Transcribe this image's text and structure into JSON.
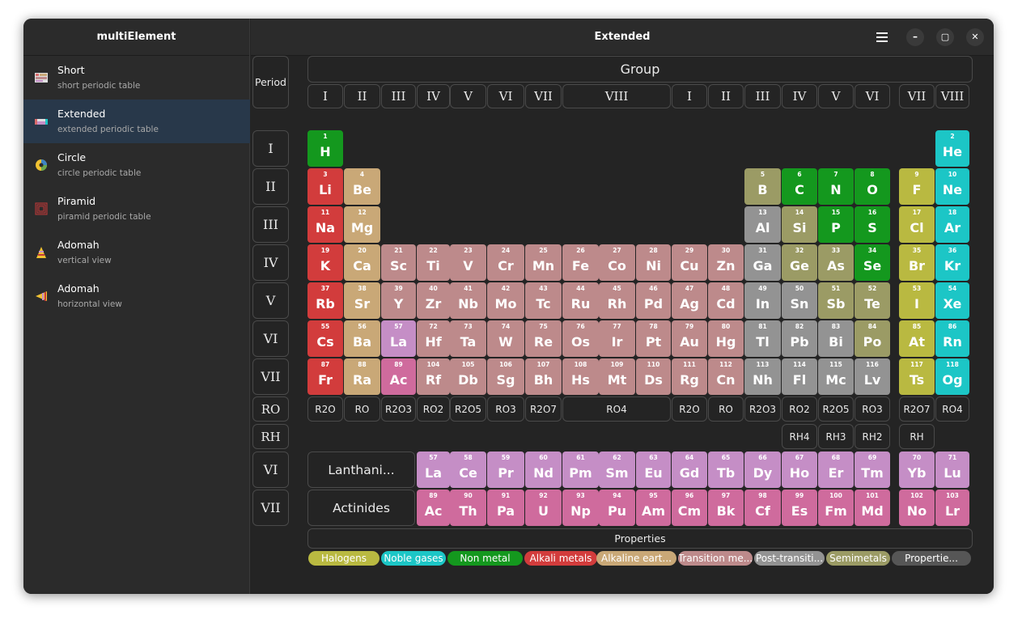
{
  "app": {
    "sidebar_title": "multiElement",
    "page_title": "Extended"
  },
  "window_buttons": {
    "minimize": "–",
    "maximize": "▢",
    "close": "✕"
  },
  "sidebar": {
    "items": [
      {
        "title": "Short",
        "subtitle": "short periodic table",
        "icon": "short-table-icon"
      },
      {
        "title": "Extended",
        "subtitle": "extended periodic table",
        "icon": "extended-table-icon"
      },
      {
        "title": "Circle",
        "subtitle": "circle periodic table",
        "icon": "circle-table-icon"
      },
      {
        "title": "Piramid",
        "subtitle": "piramid periodic table",
        "icon": "piramid-table-icon"
      },
      {
        "title": "Adomah",
        "subtitle": "vertical view",
        "icon": "adomah-vertical-icon"
      },
      {
        "title": "Adomah",
        "subtitle": "horizontal view",
        "icon": "adomah-horizontal-icon"
      }
    ],
    "active_index": 1
  },
  "headers": {
    "period": "Period",
    "group": "Group",
    "groups": [
      "I",
      "II",
      "III",
      "IV",
      "V",
      "VI",
      "VII",
      "VIII",
      "I",
      "II",
      "III",
      "IV",
      "V",
      "VI",
      "VII",
      "VIII"
    ],
    "periods": [
      "I",
      "II",
      "III",
      "IV",
      "V",
      "VI",
      "VII"
    ],
    "ro": "RO",
    "rh": "RH",
    "lanth_period": "VI",
    "actin_period": "VII",
    "lanthanides": "Lanthani...",
    "actinides": "Actinides",
    "properties": "Properties"
  },
  "colors": {
    "halogen": "#b9b941",
    "noble": "#1cc6c6",
    "nonmetal": "#14981e",
    "alkali": "#d23c3c",
    "alkaline": "#c9a877",
    "transition": "#bd8a8b",
    "post": "#939393",
    "semi": "#9b9b65",
    "lanth": "#c58ec6",
    "actin": "#cf6b9d",
    "unknown": "#565656",
    "header_bg": "#2b2b2b",
    "window_bg": "#242424",
    "sidebar_active": "#28384a"
  },
  "elements": [
    {
      "z": 1,
      "s": "H",
      "c": "nonmetal"
    },
    {
      "z": 2,
      "s": "He",
      "c": "noble"
    },
    {
      "z": 3,
      "s": "Li",
      "c": "alkali"
    },
    {
      "z": 4,
      "s": "Be",
      "c": "alkaline"
    },
    {
      "z": 5,
      "s": "B",
      "c": "semi"
    },
    {
      "z": 6,
      "s": "C",
      "c": "nonmetal"
    },
    {
      "z": 7,
      "s": "N",
      "c": "nonmetal"
    },
    {
      "z": 8,
      "s": "O",
      "c": "nonmetal"
    },
    {
      "z": 9,
      "s": "F",
      "c": "halogen"
    },
    {
      "z": 10,
      "s": "Ne",
      "c": "noble"
    },
    {
      "z": 11,
      "s": "Na",
      "c": "alkali"
    },
    {
      "z": 12,
      "s": "Mg",
      "c": "alkaline"
    },
    {
      "z": 13,
      "s": "Al",
      "c": "post"
    },
    {
      "z": 14,
      "s": "Si",
      "c": "semi"
    },
    {
      "z": 15,
      "s": "P",
      "c": "nonmetal"
    },
    {
      "z": 16,
      "s": "S",
      "c": "nonmetal"
    },
    {
      "z": 17,
      "s": "Cl",
      "c": "halogen"
    },
    {
      "z": 18,
      "s": "Ar",
      "c": "noble"
    },
    {
      "z": 19,
      "s": "K",
      "c": "alkali"
    },
    {
      "z": 20,
      "s": "Ca",
      "c": "alkaline"
    },
    {
      "z": 21,
      "s": "Sc",
      "c": "transition"
    },
    {
      "z": 22,
      "s": "Ti",
      "c": "transition"
    },
    {
      "z": 23,
      "s": "V",
      "c": "transition"
    },
    {
      "z": 24,
      "s": "Cr",
      "c": "transition"
    },
    {
      "z": 25,
      "s": "Mn",
      "c": "transition"
    },
    {
      "z": 26,
      "s": "Fe",
      "c": "transition"
    },
    {
      "z": 27,
      "s": "Co",
      "c": "transition"
    },
    {
      "z": 28,
      "s": "Ni",
      "c": "transition"
    },
    {
      "z": 29,
      "s": "Cu",
      "c": "transition"
    },
    {
      "z": 30,
      "s": "Zn",
      "c": "transition"
    },
    {
      "z": 31,
      "s": "Ga",
      "c": "post"
    },
    {
      "z": 32,
      "s": "Ge",
      "c": "semi"
    },
    {
      "z": 33,
      "s": "As",
      "c": "semi"
    },
    {
      "z": 34,
      "s": "Se",
      "c": "nonmetal"
    },
    {
      "z": 35,
      "s": "Br",
      "c": "halogen"
    },
    {
      "z": 36,
      "s": "Kr",
      "c": "noble"
    },
    {
      "z": 37,
      "s": "Rb",
      "c": "alkali"
    },
    {
      "z": 38,
      "s": "Sr",
      "c": "alkaline"
    },
    {
      "z": 39,
      "s": "Y",
      "c": "transition"
    },
    {
      "z": 40,
      "s": "Zr",
      "c": "transition"
    },
    {
      "z": 41,
      "s": "Nb",
      "c": "transition"
    },
    {
      "z": 42,
      "s": "Mo",
      "c": "transition"
    },
    {
      "z": 43,
      "s": "Tc",
      "c": "transition"
    },
    {
      "z": 44,
      "s": "Ru",
      "c": "transition"
    },
    {
      "z": 45,
      "s": "Rh",
      "c": "transition"
    },
    {
      "z": 46,
      "s": "Pd",
      "c": "transition"
    },
    {
      "z": 47,
      "s": "Ag",
      "c": "transition"
    },
    {
      "z": 48,
      "s": "Cd",
      "c": "transition"
    },
    {
      "z": 49,
      "s": "In",
      "c": "post"
    },
    {
      "z": 50,
      "s": "Sn",
      "c": "post"
    },
    {
      "z": 51,
      "s": "Sb",
      "c": "semi"
    },
    {
      "z": 52,
      "s": "Te",
      "c": "semi"
    },
    {
      "z": 53,
      "s": "I",
      "c": "halogen"
    },
    {
      "z": 54,
      "s": "Xe",
      "c": "noble"
    },
    {
      "z": 55,
      "s": "Cs",
      "c": "alkali"
    },
    {
      "z": 56,
      "s": "Ba",
      "c": "alkaline"
    },
    {
      "z": 57,
      "s": "La",
      "c": "lanth"
    },
    {
      "z": 72,
      "s": "Hf",
      "c": "transition"
    },
    {
      "z": 73,
      "s": "Ta",
      "c": "transition"
    },
    {
      "z": 74,
      "s": "W",
      "c": "transition"
    },
    {
      "z": 75,
      "s": "Re",
      "c": "transition"
    },
    {
      "z": 76,
      "s": "Os",
      "c": "transition"
    },
    {
      "z": 77,
      "s": "Ir",
      "c": "transition"
    },
    {
      "z": 78,
      "s": "Pt",
      "c": "transition"
    },
    {
      "z": 79,
      "s": "Au",
      "c": "transition"
    },
    {
      "z": 80,
      "s": "Hg",
      "c": "transition"
    },
    {
      "z": 81,
      "s": "Tl",
      "c": "post"
    },
    {
      "z": 82,
      "s": "Pb",
      "c": "post"
    },
    {
      "z": 83,
      "s": "Bi",
      "c": "post"
    },
    {
      "z": 84,
      "s": "Po",
      "c": "semi"
    },
    {
      "z": 85,
      "s": "At",
      "c": "halogen"
    },
    {
      "z": 86,
      "s": "Rn",
      "c": "noble"
    },
    {
      "z": 87,
      "s": "Fr",
      "c": "alkali"
    },
    {
      "z": 88,
      "s": "Ra",
      "c": "alkaline"
    },
    {
      "z": 89,
      "s": "Ac",
      "c": "actin"
    },
    {
      "z": 104,
      "s": "Rf",
      "c": "transition"
    },
    {
      "z": 105,
      "s": "Db",
      "c": "transition"
    },
    {
      "z": 106,
      "s": "Sg",
      "c": "transition"
    },
    {
      "z": 107,
      "s": "Bh",
      "c": "transition"
    },
    {
      "z": 108,
      "s": "Hs",
      "c": "transition"
    },
    {
      "z": 109,
      "s": "Mt",
      "c": "transition"
    },
    {
      "z": 110,
      "s": "Ds",
      "c": "transition"
    },
    {
      "z": 111,
      "s": "Rg",
      "c": "transition"
    },
    {
      "z": 112,
      "s": "Cn",
      "c": "transition"
    },
    {
      "z": 113,
      "s": "Nh",
      "c": "post"
    },
    {
      "z": 114,
      "s": "Fl",
      "c": "post"
    },
    {
      "z": 115,
      "s": "Mc",
      "c": "post"
    },
    {
      "z": 116,
      "s": "Lv",
      "c": "post"
    },
    {
      "z": 117,
      "s": "Ts",
      "c": "halogen"
    },
    {
      "z": 118,
      "s": "Og",
      "c": "noble"
    }
  ],
  "lanthanides": [
    {
      "z": 57,
      "s": "La"
    },
    {
      "z": 58,
      "s": "Ce"
    },
    {
      "z": 59,
      "s": "Pr"
    },
    {
      "z": 60,
      "s": "Nd"
    },
    {
      "z": 61,
      "s": "Pm"
    },
    {
      "z": 62,
      "s": "Sm"
    },
    {
      "z": 63,
      "s": "Eu"
    },
    {
      "z": 64,
      "s": "Gd"
    },
    {
      "z": 65,
      "s": "Tb"
    },
    {
      "z": 66,
      "s": "Dy"
    },
    {
      "z": 67,
      "s": "Ho"
    },
    {
      "z": 68,
      "s": "Er"
    },
    {
      "z": 69,
      "s": "Tm"
    },
    {
      "z": 70,
      "s": "Yb"
    },
    {
      "z": 71,
      "s": "Lu"
    }
  ],
  "actinides": [
    {
      "z": 89,
      "s": "Ac"
    },
    {
      "z": 90,
      "s": "Th"
    },
    {
      "z": 91,
      "s": "Pa"
    },
    {
      "z": 92,
      "s": "U"
    },
    {
      "z": 93,
      "s": "Np"
    },
    {
      "z": 94,
      "s": "Pu"
    },
    {
      "z": 95,
      "s": "Am"
    },
    {
      "z": 96,
      "s": "Cm"
    },
    {
      "z": 97,
      "s": "Bk"
    },
    {
      "z": 98,
      "s": "Cf"
    },
    {
      "z": 99,
      "s": "Es"
    },
    {
      "z": 100,
      "s": "Fm"
    },
    {
      "z": 101,
      "s": "Md"
    },
    {
      "z": 102,
      "s": "No"
    },
    {
      "z": 103,
      "s": "Lr"
    }
  ],
  "oxides": [
    "R2O",
    "RO",
    "R2O3",
    "RO2",
    "R2O5",
    "RO3",
    "R2O7",
    "RO4",
    "R2O",
    "RO",
    "R2O3",
    "RO2",
    "R2O5",
    "RO3",
    "R2O7",
    "RO4"
  ],
  "hydrides": [
    "RH4",
    "RH3",
    "RH2",
    "RH"
  ],
  "legend": [
    {
      "label": "Halogens",
      "c": "halogen"
    },
    {
      "label": "Noble gases",
      "c": "noble"
    },
    {
      "label": "Non metal",
      "c": "nonmetal"
    },
    {
      "label": "Alkali metals",
      "c": "alkali"
    },
    {
      "label": "Alkaline eart...",
      "c": "alkaline"
    },
    {
      "label": "Transition me...",
      "c": "transition"
    },
    {
      "label": "Post-transiti...",
      "c": "post"
    },
    {
      "label": "Semimetals",
      "c": "semi"
    },
    {
      "label": "Propertie...",
      "c": "unknown"
    }
  ]
}
